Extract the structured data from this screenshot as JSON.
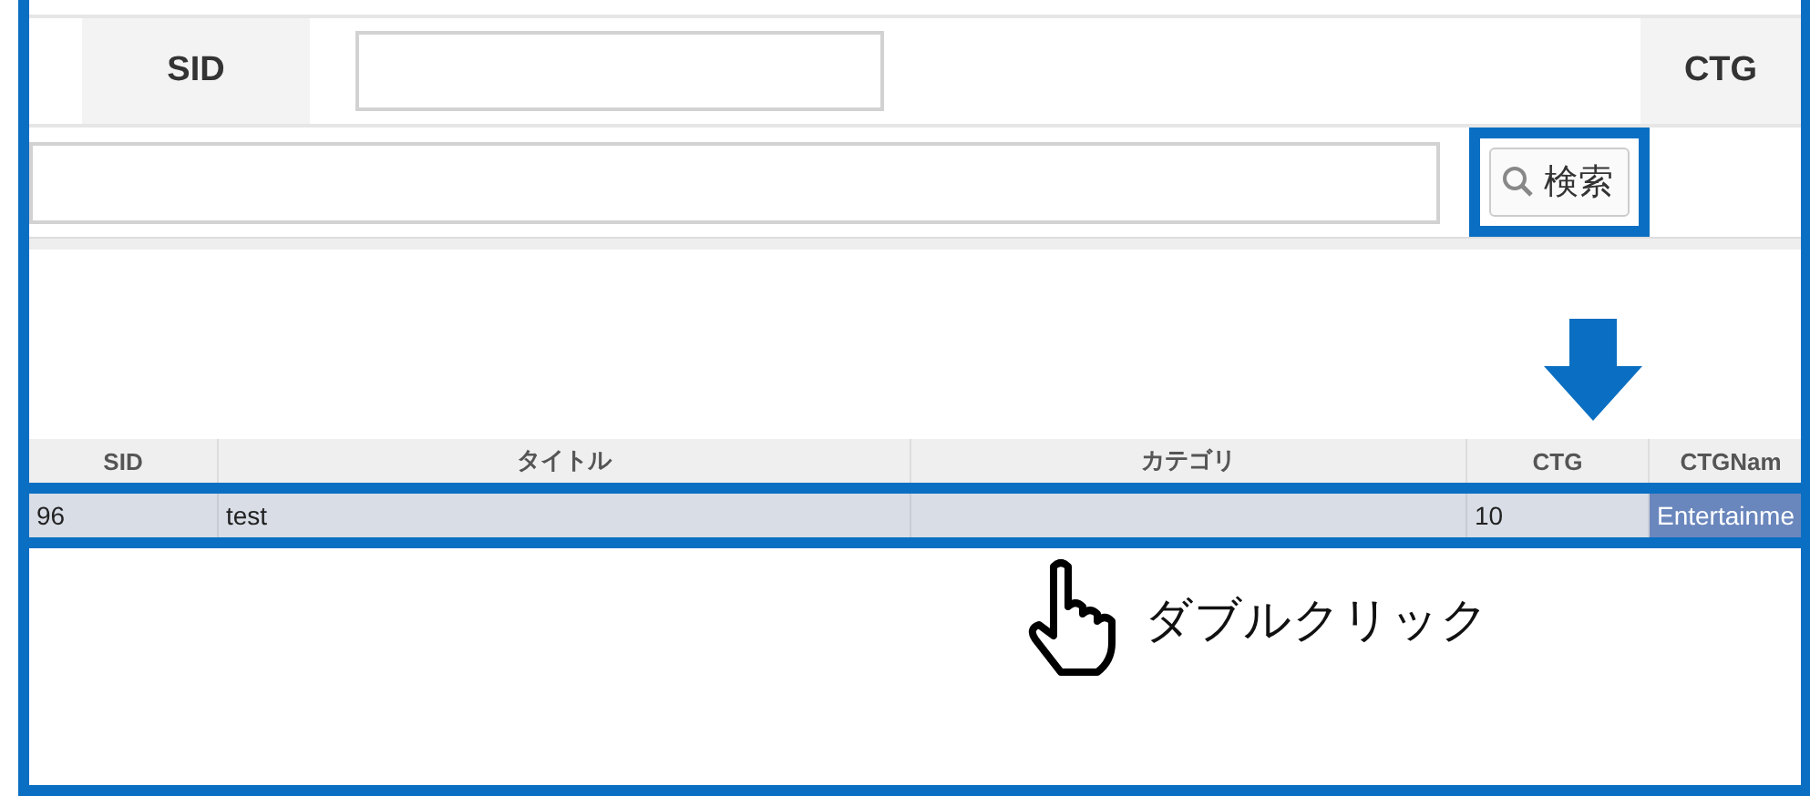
{
  "search_form": {
    "fields": [
      {
        "label": "SID"
      },
      {
        "label": "CTG"
      }
    ],
    "search_button": {
      "label": "検索"
    }
  },
  "results_table": {
    "columns": [
      "SID",
      "タイトル",
      "カテゴリ",
      "CTG",
      "CTGNam"
    ],
    "rows": [
      {
        "selected": true,
        "cells": [
          "96",
          "test",
          "",
          "10",
          "Entertainme"
        ]
      }
    ]
  },
  "annotation": {
    "text": "ダブルクリック"
  }
}
